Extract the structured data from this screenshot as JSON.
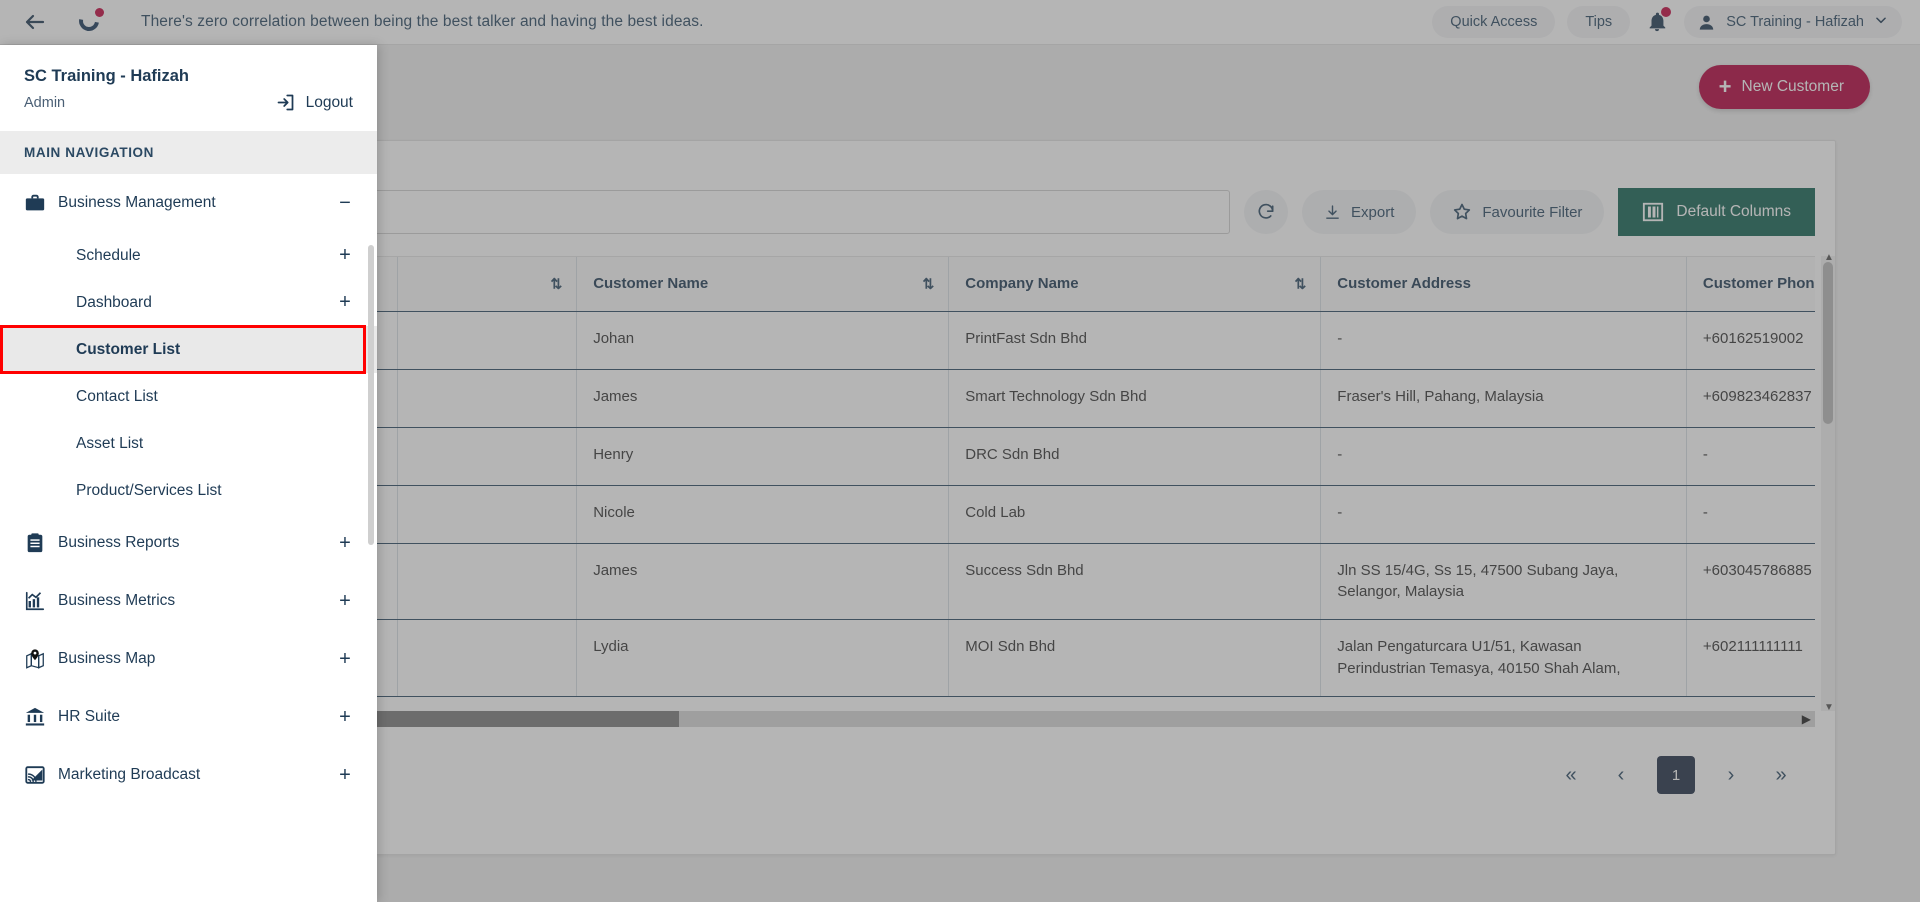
{
  "topbar": {
    "quote": "There's zero correlation between being the best talker and having the best ideas.",
    "back_icon": "back-arrow-icon",
    "quick_access": "Quick Access",
    "tips": "Tips",
    "notifications_icon": "bell-icon",
    "user_name": "SC Training - Hafizah"
  },
  "header": {
    "new_customer": "New Customer"
  },
  "toolbar": {
    "search_placeholder": "",
    "search_value": "",
    "refresh_icon": "refresh-icon",
    "export": "Export",
    "favourite_filter": "Favourite Filter",
    "default_columns": "Default Columns",
    "accent_green": "#136353",
    "accent_red": "#b4003c"
  },
  "sidebar": {
    "title": "SC Training - Hafizah",
    "role": "Admin",
    "logout": "Logout",
    "nav_header": "MAIN NAVIGATION",
    "items": [
      {
        "label": "Business Management",
        "icon": "briefcase-icon",
        "expander": "−",
        "type": "group"
      },
      {
        "label": "Schedule",
        "expander": "+",
        "type": "sub"
      },
      {
        "label": "Dashboard",
        "expander": "+",
        "type": "sub"
      },
      {
        "label": "Customer List",
        "expander": "",
        "type": "sub",
        "active": true
      },
      {
        "label": "Contact List",
        "expander": "",
        "type": "sub"
      },
      {
        "label": "Asset List",
        "expander": "",
        "type": "sub"
      },
      {
        "label": "Product/Services List",
        "expander": "",
        "type": "sub"
      },
      {
        "label": "Business Reports",
        "icon": "clipboard-icon",
        "expander": "+",
        "type": "group"
      },
      {
        "label": "Business Metrics",
        "icon": "bar-chart-icon",
        "expander": "+",
        "type": "group"
      },
      {
        "label": "Business Map",
        "icon": "map-pin-icon",
        "expander": "+",
        "type": "group"
      },
      {
        "label": "HR Suite",
        "icon": "bank-icon",
        "expander": "+",
        "type": "group"
      },
      {
        "label": "Marketing Broadcast",
        "icon": "broadcast-icon",
        "expander": "+",
        "type": "group"
      }
    ]
  },
  "table": {
    "columns": [
      {
        "label": "",
        "sortable": false,
        "key": "chk"
      },
      {
        "label": "",
        "sortable": false,
        "key": "act"
      },
      {
        "label": "",
        "sortable": true,
        "key": "id"
      },
      {
        "label": "Customer Name",
        "sortable": true,
        "key": "name"
      },
      {
        "label": "Company Name",
        "sortable": true,
        "key": "company"
      },
      {
        "label": "Customer Address",
        "sortable": false,
        "key": "address"
      },
      {
        "label": "Customer Phone",
        "sortable": false,
        "key": "phone"
      }
    ],
    "sort_icon": "⇅",
    "rows": [
      {
        "name": "Johan",
        "company": "PrintFast Sdn Bhd",
        "address": "-",
        "phone": "+60162519002"
      },
      {
        "name": "James",
        "company": "Smart Technology Sdn Bhd",
        "address": "Fraser's Hill, Pahang, Malaysia",
        "phone": "+609823462837"
      },
      {
        "name": "Henry",
        "company": "DRC Sdn Bhd",
        "address": "-",
        "phone": "-"
      },
      {
        "name": "Nicole",
        "company": "Cold Lab",
        "address": "-",
        "phone": "-"
      },
      {
        "name": "James",
        "company": "Success Sdn Bhd",
        "address": "Jln SS 15/4G, Ss 15, 47500 Subang Jaya, Selangor, Malaysia",
        "phone": "+603045786885"
      },
      {
        "name": "Lydia",
        "company": "MOI Sdn Bhd",
        "address": "Jalan Pengaturcara U1/51, Kawasan Perindustrian Temasya, 40150 Shah Alam,",
        "phone": "+602111111111"
      }
    ]
  },
  "pagination": {
    "first": "«",
    "prev": "‹",
    "current": "1",
    "next": "›",
    "last": "»"
  }
}
